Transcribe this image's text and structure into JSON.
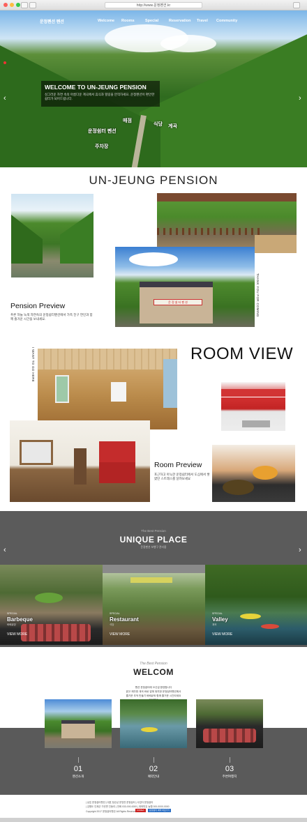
{
  "browser": {
    "url": "http://www.운정펜션.kr"
  },
  "hero": {
    "logo": "운정펜션 펜션",
    "nav": [
      "Welcome",
      "Rooms",
      "Special",
      "Reservation",
      "Travel",
      "Community"
    ],
    "welcome_title": "WELCOME TO UN-JEUNG PENSION",
    "welcome_desc": "싱그러운 자연 속의 아름다운 계곡에서 휴식과 힐링을 만끽하세요. 운정펜션이 편안한 쉼터가 되어드립니다.",
    "map_labels": {
      "pension": "운정쉼터 펜션",
      "valley": "계곡",
      "food": "식당",
      "parking": "주차장",
      "bbq": "매점"
    },
    "prev_arrow": "‹",
    "next_arrow": "›"
  },
  "pension": {
    "title": "UN-JEUNG PENSION",
    "preview_title": "Pension Preview",
    "preview_desc": "푸른 하늘 녹색 자연속의 운정쉼터펜션에서 가족 친구 연인과 함께 즐거운 시간을 보내세요.",
    "vertical_right": "THANK YOU FOR COMING",
    "vertical_left": "I WANT TO GO HERE",
    "sign_text": "운 정 쉼 터 펜 션"
  },
  "room": {
    "title": "ROOM VIEW",
    "preview_title": "Room Preview",
    "preview_desc": "포근하고 아늑한 운정쉼터에서 도심에서 쌓였던 스트레스를 날려보세요"
  },
  "unique": {
    "small": "The Best Pension",
    "title": "UNIQUE PLACE",
    "sub": "운정펜션 보행구 관리중",
    "cards": [
      {
        "caption": "SPECIAL",
        "label": "Barbeque",
        "sub": "바베큐장",
        "more": "VIEW MORE"
      },
      {
        "caption": "SPECIAL",
        "label": "Restaurant",
        "sub": "식당",
        "more": "VIEW MORE"
      },
      {
        "caption": "SPECIAL",
        "label": "Valley",
        "sub": "계곡",
        "more": "VIEW MORE"
      }
    ],
    "prev_arrow": "‹",
    "next_arrow": "›"
  },
  "welcom": {
    "small": "The Best Pension",
    "title": "WELCOM",
    "desc_lines": [
      "펜션 운정쉼터에 오신걸 환영합니다",
      "맑고 깨끗한 계곡 바로 앞에 위치한 운정쉼터펜션에서",
      "즐거운 추억 만들기 바베큐와 함께 즐거운 시간되세요",
      "운정펜션"
    ],
    "items": [
      {
        "num": "01",
        "label": "펜션소개"
      },
      {
        "num": "02",
        "label": "예약안내"
      },
      {
        "num": "03",
        "label": "주변여행지"
      }
    ]
  },
  "footer": {
    "line1": "| 상호 운정쉼터펜션   | 대표 정순남 운영관 운정쉼터   | 사업자 운정쉼터",
    "line2": "| 강원도 인제군 기린면 진동리 | 전화 033-000-0000 | 계좌번호 농협 000-0000-0000",
    "line3": "Copyright 2017 운정쉼터펜션 All Rights Reserved.",
    "btn1": "KOREA",
    "btn2": "운정쉼터 예약 바로가기"
  },
  "colors": {
    "dark_band": "#5b5b5b",
    "accent_red": "#cc2222"
  }
}
